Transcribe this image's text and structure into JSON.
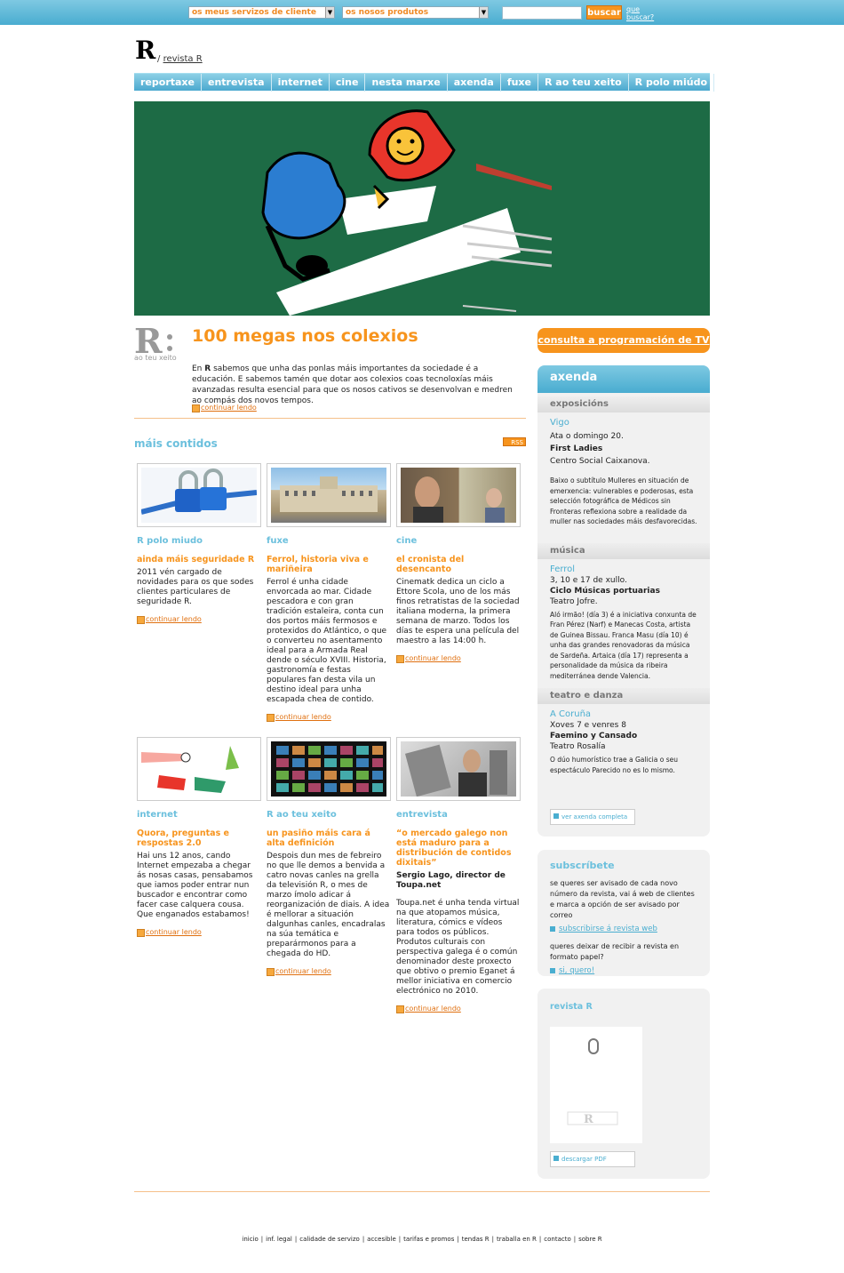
{
  "topbar": {
    "select1": "os meus servizos de cliente",
    "select2": "os nosos produtos",
    "search_button": "buscar",
    "help_link": "que buscar?"
  },
  "header": {
    "logo": "R",
    "breadcrumb_sep": "/",
    "breadcrumb": "revista R"
  },
  "nav": [
    "reportaxe",
    "entrevista",
    "internet",
    "cine",
    "nesta marxe",
    "axenda",
    "fuxe",
    "R ao teu xeito",
    "R polo miúdo"
  ],
  "featured": {
    "logo_caption": "ao teu xeito",
    "title": "100 megas nos colexios",
    "text_pre": "En ",
    "text_bold": "R",
    "text_post": " sabemos que unha das ponlas máis importantes da sociedade é a educación. E sabemos tamén que dotar aos colexios coas tecnoloxías máis avanzadas resulta esencial para que os nosos cativos se desenvolvan e medren ao compás dos novos tempos.",
    "continue": "continuar lendo"
  },
  "more": {
    "title": "máis contidos",
    "rss": "RSS"
  },
  "cards": [
    {
      "section": "R polo miudo",
      "title": "ainda máis seguridade R",
      "body": "2011 vén cargado de novidades para os que sodes clientes particulares de seguridade R.",
      "continue": "continuar lendo"
    },
    {
      "section": "fuxe",
      "title": "Ferrol, historia viva e mariñeira",
      "body": "Ferrol é unha cidade envorcada ao mar. Cidade pescadora e con gran tradición estaleira, conta cun dos portos máis fermosos e protexidos do Atlántico, o que o converteu no asentamento ideal para a Armada Real dende o século XVIII. Historia, gastronomía e festas populares fan desta vila un destino ideal para unha escapada chea de contido.",
      "continue": "continuar lendo"
    },
    {
      "section": "cine",
      "title": "el cronista del desencanto",
      "body": "Cinematk dedica un ciclo a Ettore Scola, uno de los más finos retratistas de la sociedad italiana moderna, la primera semana de marzo. Todos los días te espera una película del maestro a las 14:00 h.",
      "continue": "continuar lendo"
    },
    {
      "section": "internet",
      "title": "Quora, preguntas e respostas 2.0",
      "body": "Hai uns 12 anos, cando Internet empezaba a chegar ás nosas casas, pensabamos que iamos poder entrar nun buscador e encontrar como facer case calquera cousa. Que enganados estabamos!",
      "continue": "continuar lendo"
    },
    {
      "section": "R ao teu xeito",
      "title": "un pasiño máis cara á alta definición",
      "body": "Despois dun mes de febreiro no que lle demos a benvida a catro novas canles na grella da televisión R, o mes de marzo ímolo adicar á reorganización de diais. A idea é mellorar a situación dalgunhas canles, encadralas na súa temática e preparármonos para a chegada do HD.",
      "continue": "continuar lendo"
    },
    {
      "section": "entrevista",
      "title": "“o mercado galego non está maduro para a distribución de contidos dixitais”",
      "body": "Sergio Lago, director de Toupa.net",
      "body2": "Toupa.net é unha tenda virtual na que atopamos música, literatura, cómics e vídeos para todos os públicos. Produtos culturais con perspectiva galega é o común denominador deste proxecto que obtivo o premio Eganet á mellor iniciativa en comercio electrónico no 2010.",
      "continue": "continuar lendo"
    }
  ],
  "sidebar": {
    "tv_button": "consulta a programación de TV",
    "agenda_title": "axenda",
    "agenda": [
      {
        "section": "exposicións",
        "city": "Vigo",
        "date": "Ata o domingo 20.",
        "event": "First Ladies",
        "venue": "Centro Social Caixanova.",
        "desc": "Baixo o subtítulo Mulleres en situación de emerxencia: vulnerables e poderosas, esta selección fotográfica de Médicos sin Fronteras reflexiona sobre a realidade da muller nas sociedades máis desfavorecidas."
      },
      {
        "section": "música",
        "city": "Ferrol",
        "date": "3, 10 e 17 de xullo.",
        "event": "Ciclo Músicas portuarias",
        "venue": "Teatro Jofre.",
        "desc": "Aló irmão! (día 3) é a iniciativa conxunta de Fran Pérez (Narf) e Manecas Costa, artista de Guinea Bissau. Franca Masu (día 10) é unha das grandes renovadoras da música de Sardeña. Artaica (día 17) representa a personalidade da música da ribeira mediterránea dende Valencia."
      },
      {
        "section": "teatro e danza",
        "city": "A Coruña",
        "date": "Xoves 7 e venres 8",
        "event": "Faemino y Cansado",
        "venue": "Teatro Rosalía",
        "desc": "O dúo humorístico trae a Galicia o seu espectáculo Parecido no es lo mismo."
      }
    ],
    "full_agenda": "ver axenda completa",
    "subscribe": {
      "title": "subscríbete",
      "text1": "se queres ser avisado de cada novo número da revista, vai á web de clientes e marca a opción de ser avisado por correo",
      "link1": "subscribirse á revista web",
      "text2": "queres deixar de recibir a revista en formato papel?",
      "link2": "si, quero!"
    },
    "magazine": {
      "title": "revista R",
      "download": "descargar PDF"
    }
  },
  "footer": [
    "inicio",
    "inf. legal",
    "calidade de servizo",
    "accesible",
    "tarifas e promos",
    "tendas R",
    "traballa en R",
    "contacto",
    "sobre R"
  ],
  "colors": {
    "accent": "#f7941d",
    "blue": "#4aaed0",
    "hero_bg": "#1d6b45"
  }
}
